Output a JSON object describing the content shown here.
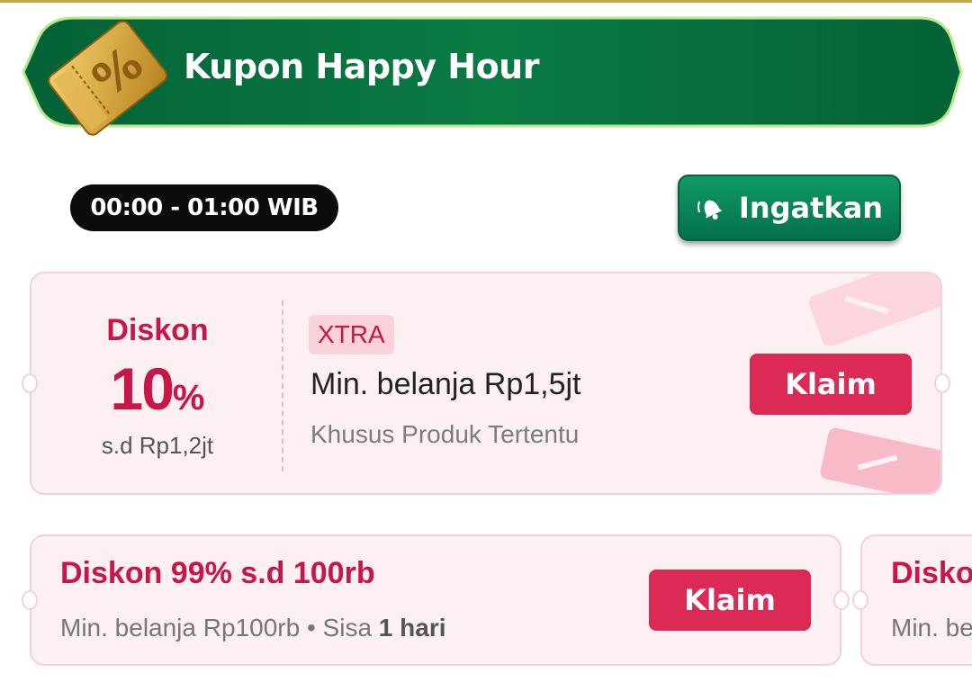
{
  "banner": {
    "title": "Kupon Happy Hour",
    "icon": "percent-coupon-icon",
    "colors": {
      "dark_green": "#046b3c",
      "light_green": "#0f8a4f",
      "gold": "#d9a637"
    }
  },
  "schedule": {
    "time_range": "00:00 - 01:00 WIB"
  },
  "remind_button": {
    "label": "Ingatkan",
    "icon": "bell-icon"
  },
  "coupons": [
    {
      "discount_label": "Diskon",
      "discount_value": "10",
      "discount_unit": "%",
      "max_discount": "s.d Rp1,2jt",
      "tag": "XTRA",
      "min_purchase": "Min. belanja Rp1,5jt",
      "scope": "Khusus Produk Tertentu",
      "claim_label": "Klaim"
    },
    {
      "title": "Diskon 99% s.d 100rb",
      "min_purchase": "Min. belanja Rp100rb",
      "separator": "•",
      "remaining_prefix": "Sisa",
      "remaining_value": "1 hari",
      "claim_label": "Klaim"
    },
    {
      "title": "Disko",
      "min_purchase": "Min. be"
    }
  ],
  "colors": {
    "accent": "#dc2a56",
    "card_bg": "#fdf0f2",
    "card_border": "#f5d0d6"
  }
}
